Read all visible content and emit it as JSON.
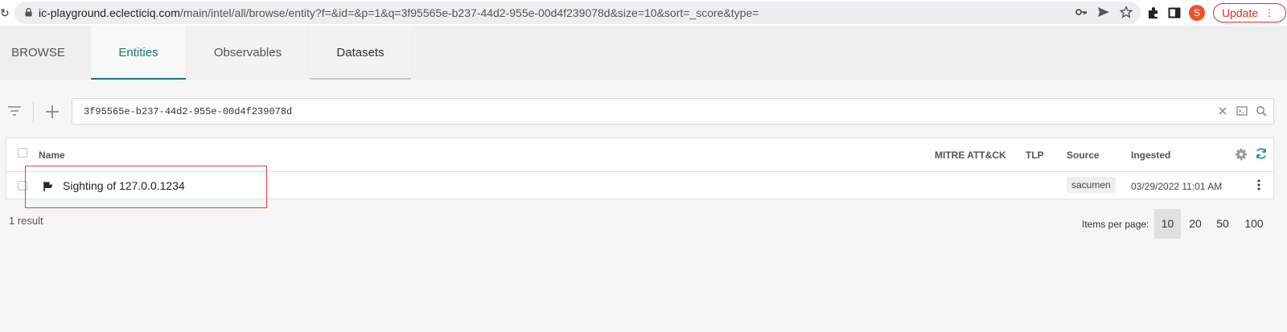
{
  "browser": {
    "url_host": "ic-playground.eclecticiq.com",
    "url_path": "/main/intel/all/browse/entity?f=&id=&p=1&q=3f95565e-b237-44d2-955e-00d4f239078d&size=10&sort=_score&type=",
    "profile_initial": "S",
    "update_label": "Update"
  },
  "tabs": [
    {
      "label": "BROWSE"
    },
    {
      "label": "Entities"
    },
    {
      "label": "Observables"
    },
    {
      "label": "Datasets"
    }
  ],
  "search": {
    "value": "3f95565e-b237-44d2-955e-00d4f239078d"
  },
  "table": {
    "columns": {
      "name": "Name",
      "mitre": "MITRE ATT&CK",
      "tlp": "TLP",
      "source": "Source",
      "ingested": "Ingested"
    },
    "rows": [
      {
        "name": "Sighting of 127.0.0.1234",
        "icon": "flag-icon",
        "source": "sacumen",
        "ingested": "03/29/2022 11:01 AM"
      }
    ]
  },
  "footer": {
    "result_count": "1 result",
    "items_per_page_label": "Items per page:",
    "page_sizes": [
      "10",
      "20",
      "50",
      "100"
    ],
    "selected_page_size": "10"
  },
  "colors": {
    "accent": "#1d7868",
    "highlight": "#e04545",
    "update": "#d93025",
    "avatar": "#e8562a"
  }
}
